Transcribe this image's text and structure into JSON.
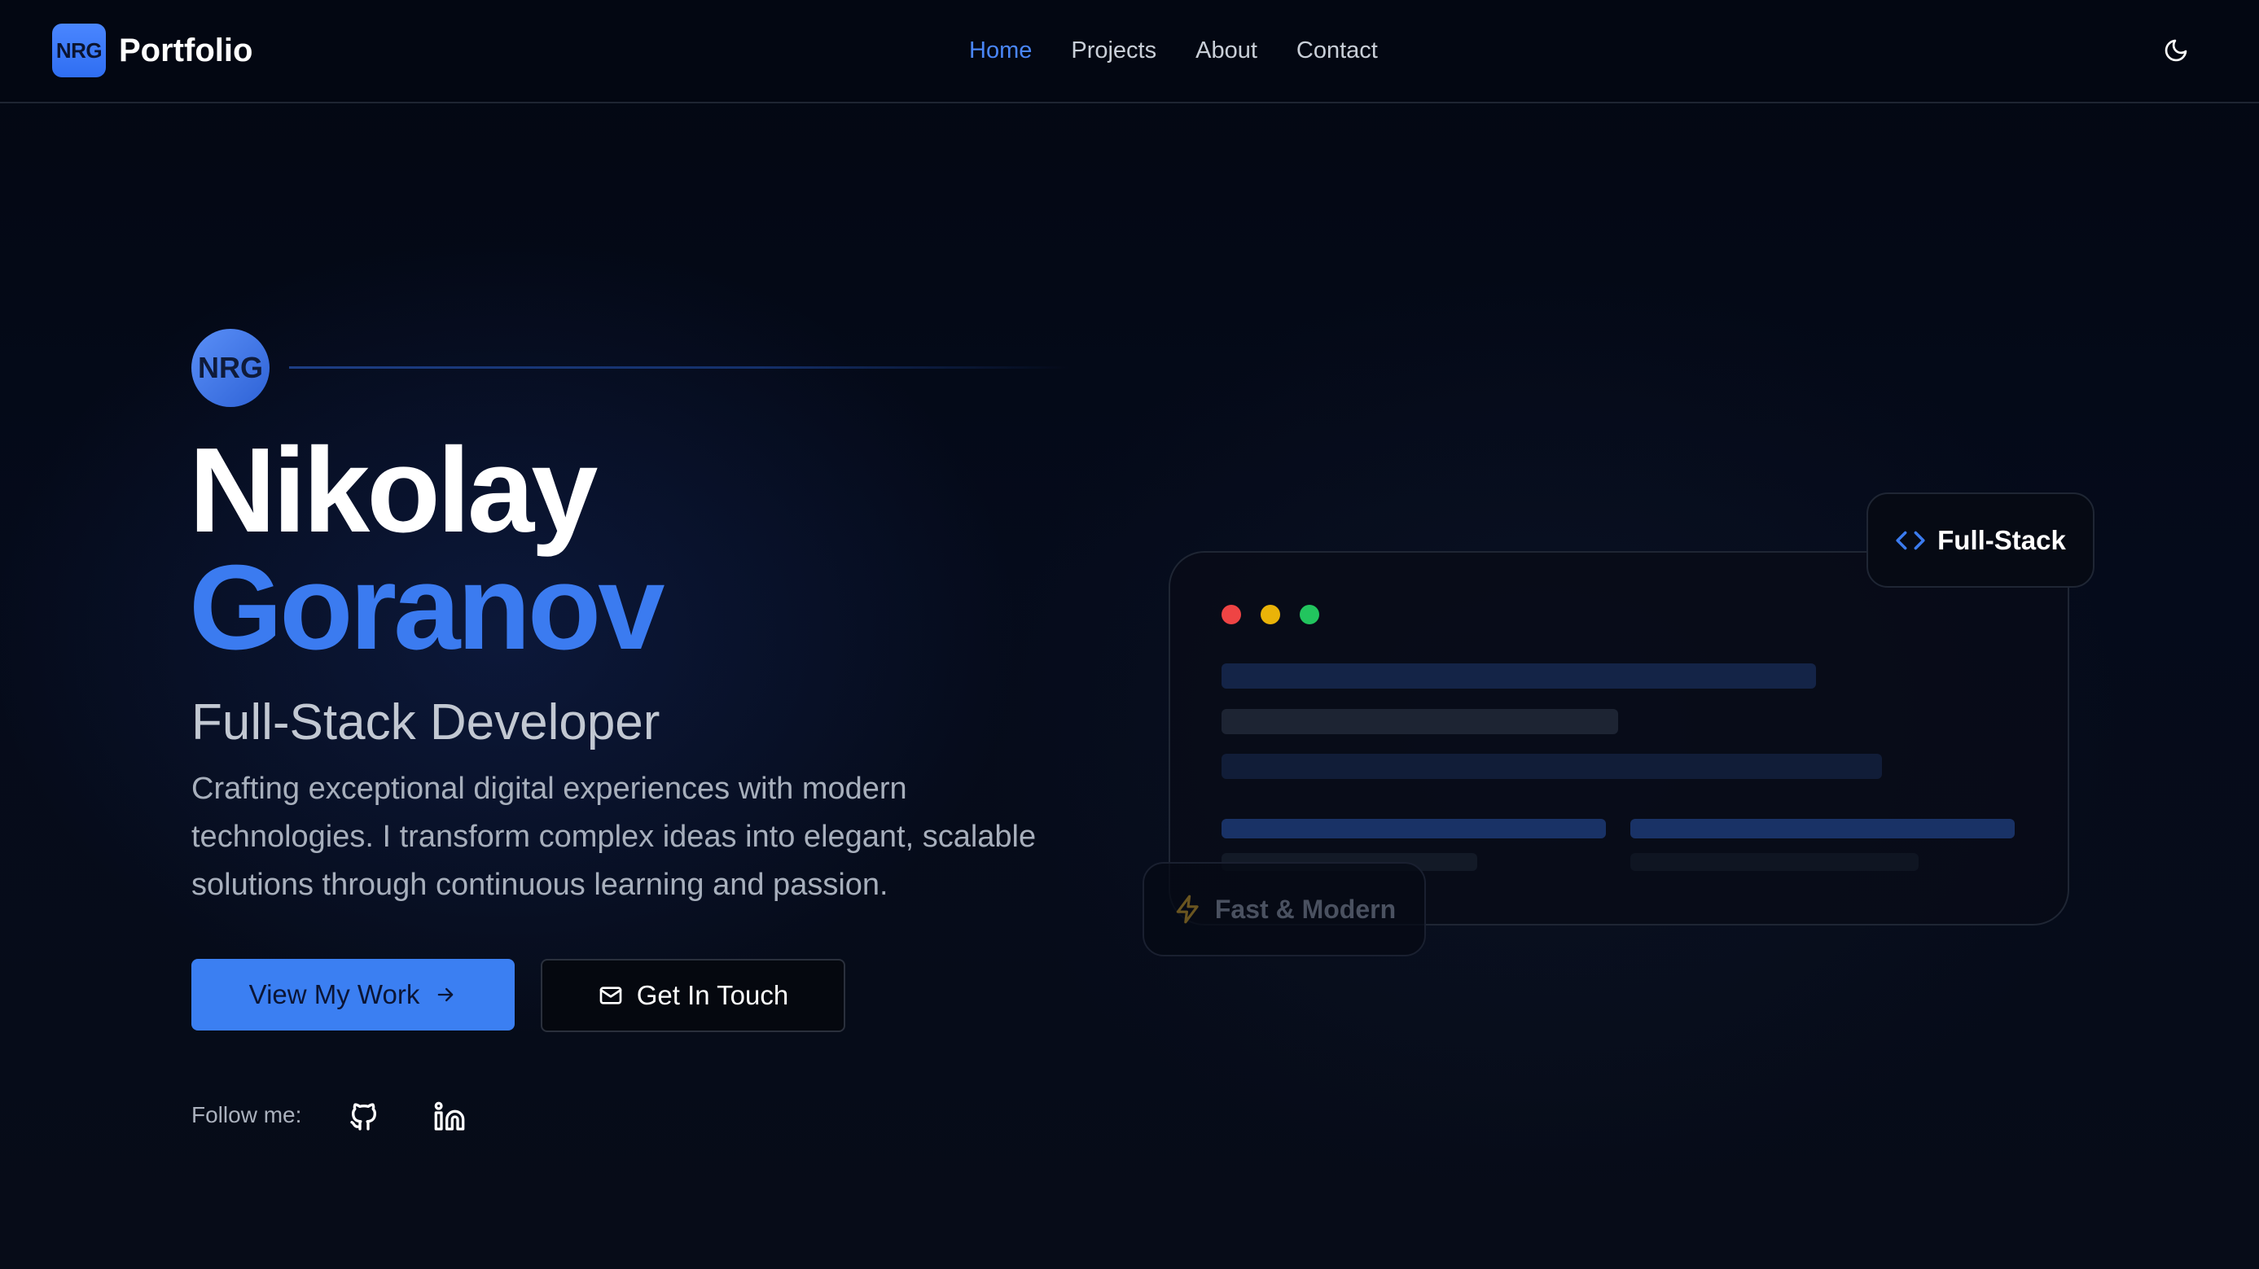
{
  "navbar": {
    "logo_text": "NRG",
    "brand": "Portfolio",
    "links": [
      {
        "label": "Home",
        "active": true
      },
      {
        "label": "Projects",
        "active": false
      },
      {
        "label": "About",
        "active": false
      },
      {
        "label": "Contact",
        "active": false
      }
    ],
    "theme_toggle_icon": "moon-icon"
  },
  "hero": {
    "avatar_text": "NRG",
    "first_name": "Nikolay",
    "last_name": "Goranov",
    "role": "Full-Stack Developer",
    "description": "Crafting exceptional digital experiences with modern technologies. I transform complex ideas into elegant, scalable solutions through continuous learning and passion.",
    "primary_button": "View My Work",
    "secondary_button": "Get In Touch",
    "follow_label": "Follow me:",
    "socials": [
      "github-icon",
      "linkedin-icon"
    ]
  },
  "showcase": {
    "badge_top": "Full-Stack",
    "badge_bottom": "Fast & Modern",
    "window_dots": [
      "#ef4444",
      "#eab308",
      "#22c55e"
    ]
  },
  "colors": {
    "accent": "#3b7bf0",
    "background": "#030712"
  }
}
